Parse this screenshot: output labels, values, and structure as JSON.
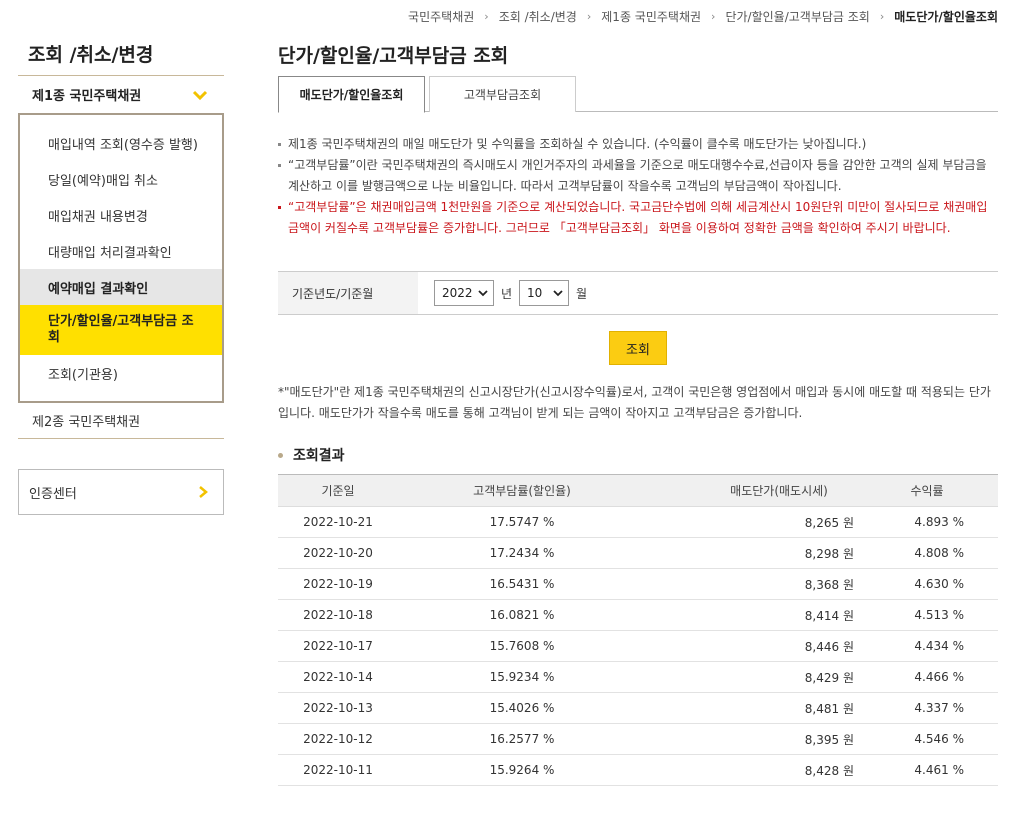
{
  "breadcrumb": [
    "국민주택채권",
    "조회 /취소/변경",
    "제1종 국민주택채권",
    "단가/할인율/고객부담금 조회",
    "매도단가/할인율조회"
  ],
  "sidebar": {
    "title": "조회 /취소/변경",
    "category1": "제1종 국민주택채권",
    "items": [
      {
        "label": "매입내역 조회(영수증 발행)"
      },
      {
        "label": "당일(예약)매입 취소"
      },
      {
        "label": "매입채권 내용변경"
      },
      {
        "label": "대량매입 처리결과확인"
      },
      {
        "label": "예약매입 결과확인"
      },
      {
        "label": "단가/할인율/고객부담금 조회"
      },
      {
        "label": "조회(기관용)"
      }
    ],
    "category2": "제2종 국민주택채권",
    "cert": "인증센터"
  },
  "main": {
    "title": "단가/할인율/고객부담금 조회",
    "tabs": [
      {
        "label": "매도단가/할인율조회"
      },
      {
        "label": "고객부담금조회"
      }
    ],
    "notes": [
      "제1종 국민주택채권의 매일 매도단가 및 수익률을 조회하실 수 있습니다. (수익률이 클수록 매도단가는 낮아집니다.)",
      "“고객부담률”이란 국민주택채권의 즉시매도시 개인거주자의 과세율을 기준으로 매도대행수수료,선급이자 등을 감안한 고객의 실제 부담금을 계산하고 이를 발행금액으로 나눈 비율입니다. 따라서 고객부담률이 작을수록 고객님의 부담금액이 작아집니다.",
      "“고객부담률”은 채권매입금액 1천만원을 기준으로 계산되었습니다. 국고금단수법에 의해 세금계산시 10원단위 미만이 절사되므로 채권매입금액이 커질수록 고객부담률은 증가합니다. 그러므로 「고객부담금조회」 화면을 이용하여 정확한 금액을 확인하여 주시기 바랍니다."
    ],
    "filter": {
      "label": "기준년도/기준월",
      "year": "2022",
      "year_unit": "년",
      "month": "10",
      "month_unit": "월"
    },
    "search_label": "조회",
    "description": "*\"매도단가\"란 제1종 국민주택채권의 신고시장단가(신고시장수익률)로서, 고객이 국민은행 영업점에서 매입과 동시에 매도할 때 적용되는 단가입니다. 매도단가가 작을수록 매도를 통해 고객님이 받게 되는 금액이 작아지고 고객부담금은 증가합니다.",
    "result_title": "조회결과",
    "table": {
      "headers": [
        "기준일",
        "고객부담률(할인율)",
        "매도단가(매도시세)",
        "수익률"
      ],
      "rows": [
        [
          "2022-10-21",
          "17.5747 %",
          "8,265 원",
          "4.893 %"
        ],
        [
          "2022-10-20",
          "17.2434 %",
          "8,298 원",
          "4.808 %"
        ],
        [
          "2022-10-19",
          "16.5431 %",
          "8,368 원",
          "4.630 %"
        ],
        [
          "2022-10-18",
          "16.0821 %",
          "8,414 원",
          "4.513 %"
        ],
        [
          "2022-10-17",
          "15.7608 %",
          "8,446 원",
          "4.434 %"
        ],
        [
          "2022-10-14",
          "15.9234 %",
          "8,429 원",
          "4.466 %"
        ],
        [
          "2022-10-13",
          "15.4026 %",
          "8,481 원",
          "4.337 %"
        ],
        [
          "2022-10-12",
          "16.2577 %",
          "8,395 원",
          "4.546 %"
        ],
        [
          "2022-10-11",
          "15.9264 %",
          "8,428 원",
          "4.461 %"
        ]
      ]
    }
  },
  "colors": {
    "accent_yellow": "#ffe000",
    "button_yellow": "#fbcc12",
    "warning_red": "#c9161b"
  }
}
